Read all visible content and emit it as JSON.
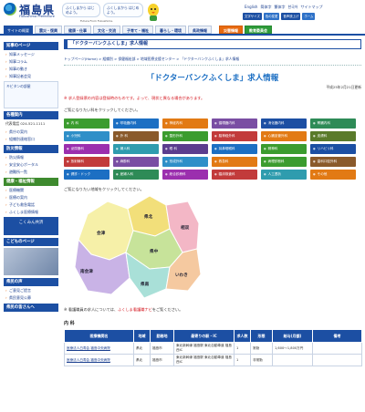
{
  "header": {
    "logo_title": "福島県",
    "logo_sub": "Fukushima Prefecture",
    "slogan1": "ふくしまから はじめよう。",
    "slogan2": "ふくしまから はじめよう。",
    "tagline": "Future From Fukushima.",
    "languages": [
      "English",
      "简体字",
      "繁体字",
      "한국어",
      "サイトマップ"
    ],
    "utilities": [
      "文字サイズ",
      "色の変更",
      "音声読上げ",
      "ホーム"
    ]
  },
  "nav": {
    "items": [
      "サイトの概要",
      "震災・復興",
      "健康・仕事",
      "文化・交流",
      "子育て・福祉",
      "暮らし・環境",
      "県政情報"
    ],
    "orange": "災害情報",
    "green": "教育委員会"
  },
  "sidebar": {
    "head1": "知事のページ",
    "items1": [
      "知事メッセージ",
      "知事コラム",
      "知事の動き",
      "知事記者会見"
    ],
    "kibitan": "キビタンの部屋",
    "head2": "各種案内",
    "phone": "代表電話 024-521-1111",
    "items2": [
      "県庁の案内",
      "組織別連絡窓口"
    ],
    "head3": "防災情報",
    "items3": [
      "防災情報",
      "安全安心ポータル",
      "避難所一覧"
    ],
    "head4": "健康・福祉情報",
    "items4": [
      "医療機関",
      "医療の案内",
      "子ども救急電話",
      "ふくしま医療情報"
    ],
    "banner": "こくみん共済",
    "head5": "こどものページ",
    "head6": "県民の声",
    "items6": [
      "ご意見ご提言",
      "県民意見公募"
    ],
    "head7": "県民の皆さんへ"
  },
  "main": {
    "page_head": "「ドクターバンクふくしま」求人情報",
    "breadcrumb": "トップページ(Home) > 組織別 > 保健福祉部 > 地域医療支援センター > 「ドクターバンクふくしま」求人情報",
    "title": "「ドクターバンクふくしま」求人情報",
    "updated": "平成25年2月21日更新",
    "warning": "※ 求人登録票の内容は登録時のものです。よって、現状と異なる場合があります。",
    "select_job": "ご覧になりたい科をクリックしてください。",
    "select_area": "ご覧になりたい地域をクリックしてください。",
    "nurse_note_pre": "※ 看護職員の求人については、",
    "nurse_note_link": "ふくしま看護職ナビ",
    "nurse_note_post": "をご覧ください。",
    "section": "内 科"
  },
  "departments": [
    {
      "label": "内 科",
      "color": "#3b9c2f"
    },
    {
      "label": "呼吸器内科",
      "color": "#1c6fc3"
    },
    {
      "label": "神経内科",
      "color": "#e27a14"
    },
    {
      "label": "循環器内科",
      "color": "#7a4ea3"
    },
    {
      "label": "消化器内科",
      "color": "#1c4fa3"
    },
    {
      "label": "腎臓内科",
      "color": "#2e8b57"
    },
    {
      "label": "小児科",
      "color": "#2f8fc8"
    },
    {
      "label": "外 科",
      "color": "#8a5a2b"
    },
    {
      "label": "整形外科",
      "color": "#3b9c2f"
    },
    {
      "label": "脳神経外科",
      "color": "#c23b3b"
    },
    {
      "label": "心臓血管外科",
      "color": "#e27a14"
    },
    {
      "label": "皮膚科",
      "color": "#5a7a2a"
    },
    {
      "label": "泌尿器科",
      "color": "#9b2fae"
    },
    {
      "label": "婦人科",
      "color": "#2f9cae"
    },
    {
      "label": "眼 科",
      "color": "#5b3d8e"
    },
    {
      "label": "耳鼻咽喉科",
      "color": "#1c6fc3"
    },
    {
      "label": "精神科",
      "color": "#3b9c2f"
    },
    {
      "label": "リハビリ科",
      "color": "#1c4fa3"
    },
    {
      "label": "放射線科",
      "color": "#c23b3b"
    },
    {
      "label": "麻酔科",
      "color": "#7a4ea3"
    },
    {
      "label": "形成外科",
      "color": "#2f8fc8"
    },
    {
      "label": "救急科",
      "color": "#e27a14"
    },
    {
      "label": "病理診断科",
      "color": "#3b9c2f"
    },
    {
      "label": "歯科口腔外科",
      "color": "#8a5a2b"
    },
    {
      "label": "健診・ドック",
      "color": "#1c6fc3"
    },
    {
      "label": "産婦人科",
      "color": "#2e8b57"
    },
    {
      "label": "総合診療科",
      "color": "#9b2fae"
    },
    {
      "label": "臨床検査科",
      "color": "#c23b3b"
    },
    {
      "label": "人工透析",
      "color": "#2f9cae"
    },
    {
      "label": "その他",
      "color": "#e27a14"
    }
  ],
  "regions": [
    {
      "label": "県北",
      "color": "#f2df7a"
    },
    {
      "label": "相双",
      "color": "#f3b7c6"
    },
    {
      "label": "県中",
      "color": "#c7e39a"
    },
    {
      "label": "会津",
      "color": "#f6f0a8"
    },
    {
      "label": "南会津",
      "color": "#c9b3e6"
    },
    {
      "label": "県南",
      "color": "#a9e0d8"
    },
    {
      "label": "いわき",
      "color": "#f5c9a0"
    }
  ],
  "table": {
    "headers": [
      "医療機関名",
      "地域",
      "勤務地",
      "最寄りの駅・IC",
      "求人数",
      "形態",
      "給与(月額)",
      "備考"
    ],
    "rows": [
      [
        "医療法人白寿会 福島中央病院",
        "県北",
        "福島市",
        "東北新幹線 福島駅 東北自動車道 福島西IC",
        "1",
        "常勤",
        "1,600～1,800万円",
        ""
      ],
      [
        "医療法人白寿会 福島中央病院",
        "県北",
        "福島市",
        "東北新幹線 福島駅 東北自動車道 福島西IC",
        "1",
        "非常勤",
        "",
        ""
      ]
    ]
  }
}
